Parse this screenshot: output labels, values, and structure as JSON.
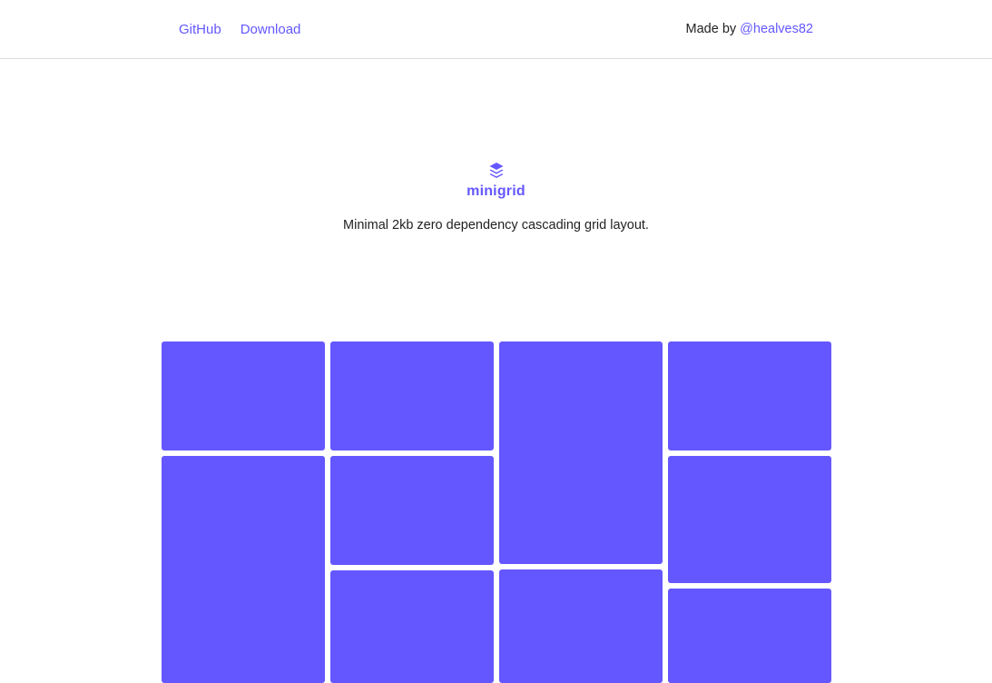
{
  "nav": {
    "links": [
      {
        "label": "GitHub"
      },
      {
        "label": "Download"
      }
    ]
  },
  "credit": {
    "prefix": "Made by",
    "handle": "@healves82"
  },
  "hero": {
    "logo_icon": "stacked-layers-icon",
    "brand": "minigrid",
    "tagline": "Minimal 2kb zero dependency cascading grid layout."
  },
  "colors": {
    "accent": "#6457ff",
    "text": "#222222",
    "divider": "#dcdcdc"
  }
}
